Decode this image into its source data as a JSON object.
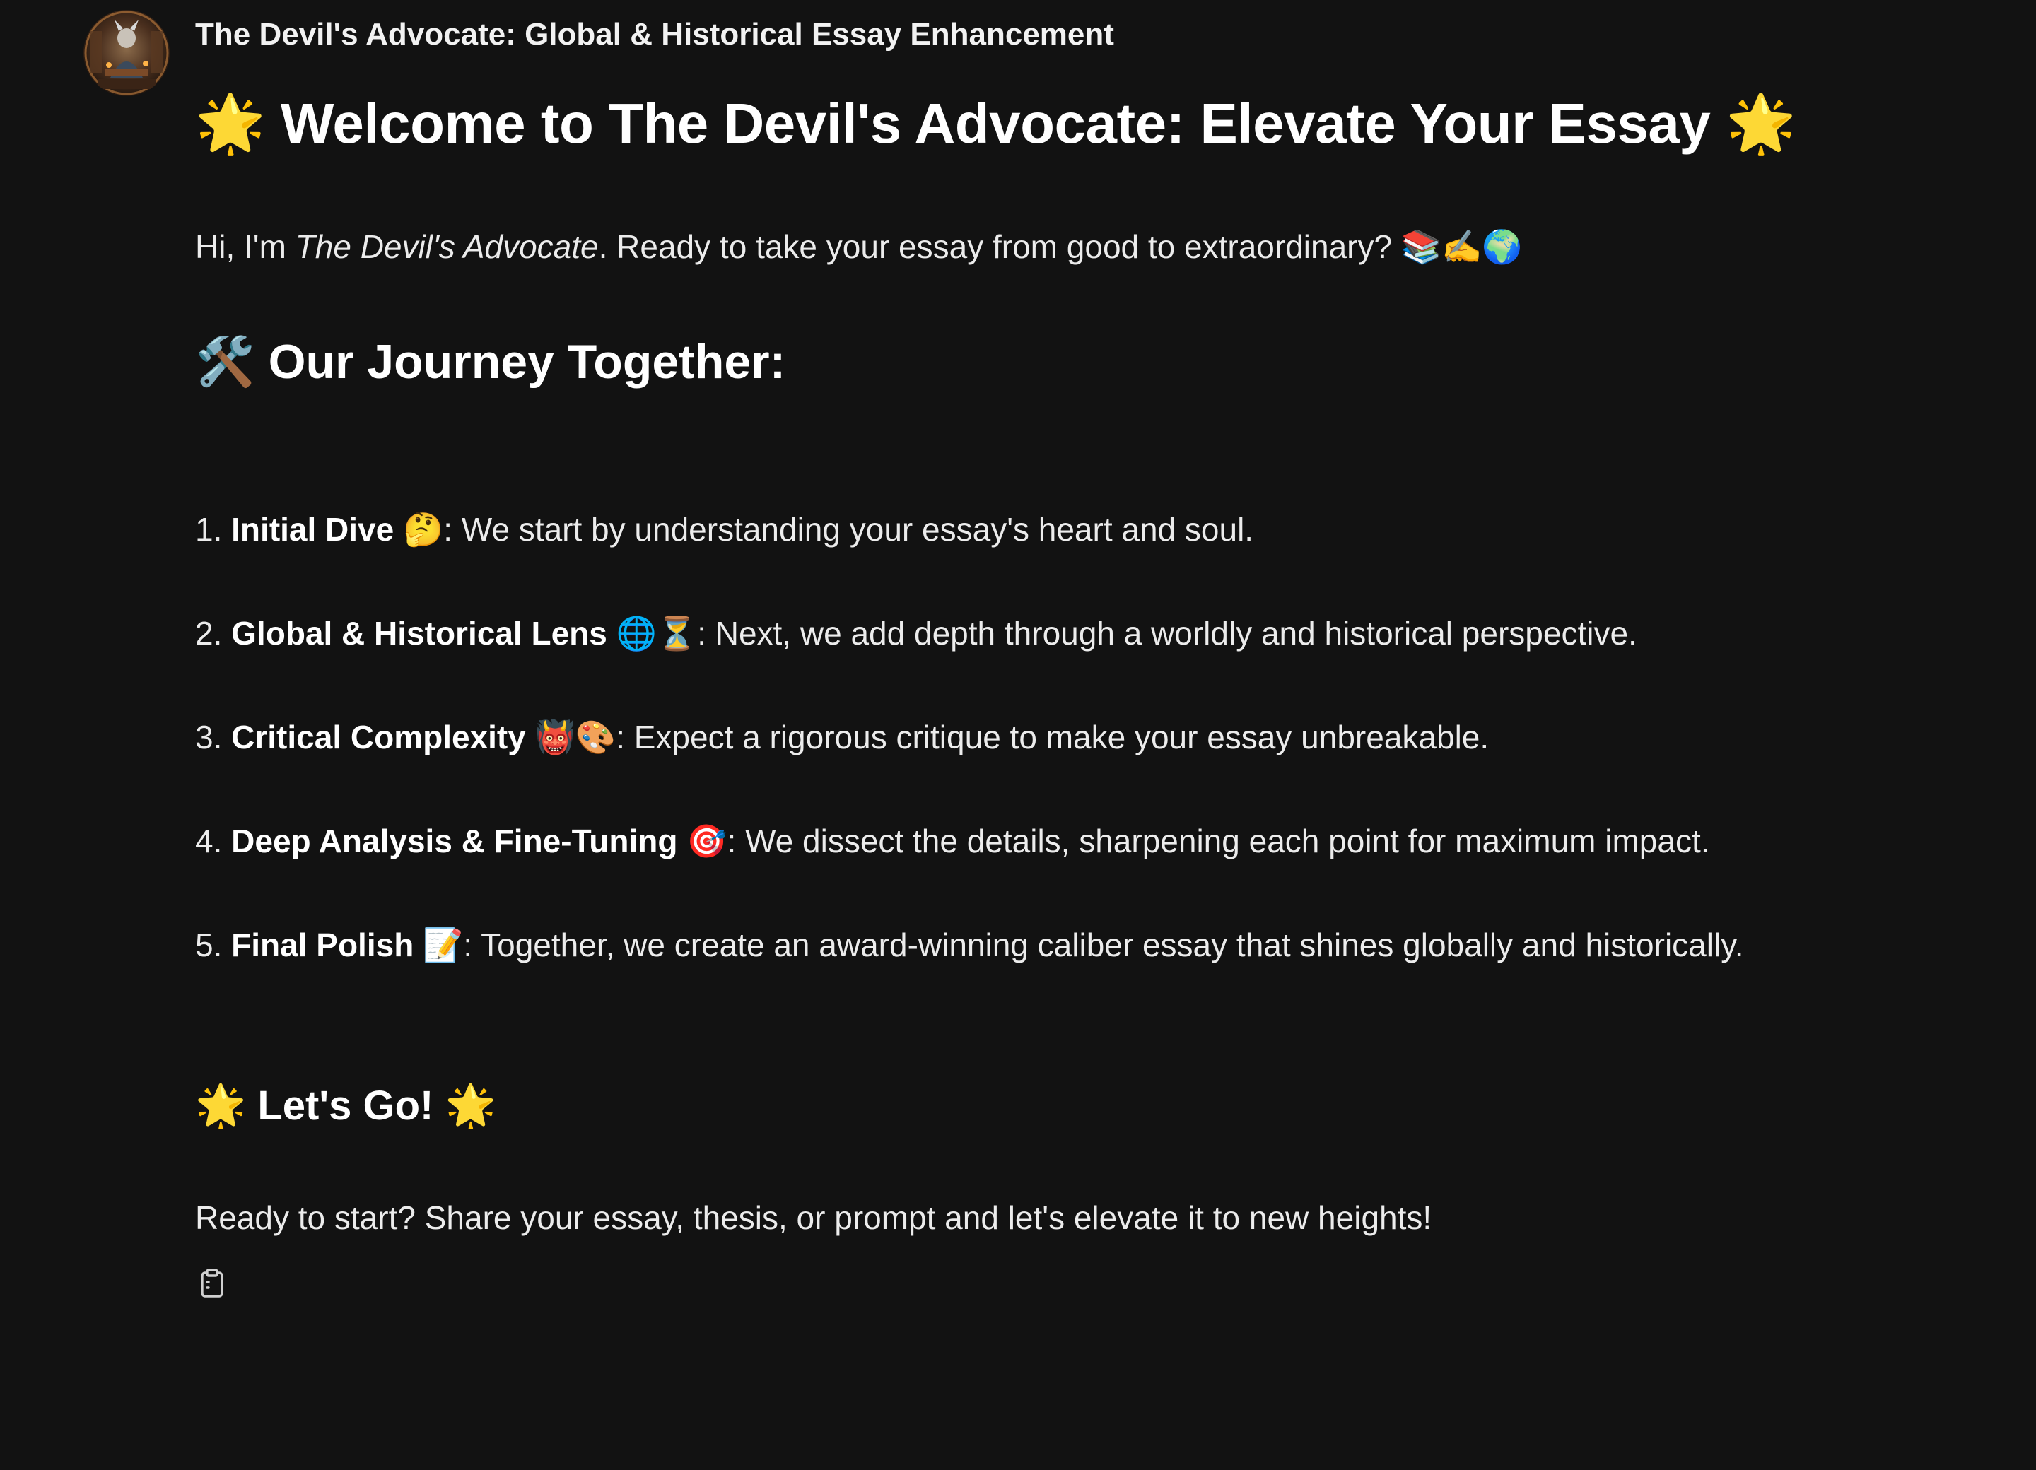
{
  "header": {
    "author": "The Devil's Advocate: Global & Historical Essay Enhancement"
  },
  "message": {
    "title_prefix": "🌟",
    "title_text": "Welcome to The Devil's Advocate: Elevate Your Essay",
    "title_suffix": "🌟",
    "intro_start": "Hi, I'm ",
    "intro_name": "The Devil's Advocate",
    "intro_end": ". Ready to take your essay from good to extraordinary? 📚✍️🌍",
    "journey_icon": "🛠️",
    "journey_heading": "Our Journey Together:",
    "steps": [
      {
        "num": "1.",
        "title": "Initial Dive",
        "emoji": "🤔",
        "text": ": We start by understanding your essay's heart and soul."
      },
      {
        "num": "2.",
        "title": "Global & Historical Lens",
        "emoji": "🌐⏳",
        "text": ": Next, we add depth through a worldly and historical perspective."
      },
      {
        "num": "3.",
        "title": "Critical Complexity",
        "emoji": "👹🎨",
        "text": ": Expect a rigorous critique to make your essay unbreakable."
      },
      {
        "num": "4.",
        "title": "Deep Analysis & Fine-Tuning",
        "emoji": "🎯",
        "text": ": We dissect the details, sharpening each point for maximum impact."
      },
      {
        "num": "5.",
        "title": "Final Polish",
        "emoji": "📝",
        "text": ": Together, we create an award-winning caliber essay that shines globally and historically."
      }
    ],
    "go_prefix": "🌟",
    "go_heading": "Let's Go!",
    "go_suffix": "🌟",
    "outro": "Ready to start? Share your essay, thesis, or prompt and let's elevate it to new heights!"
  },
  "icons": {
    "avatar": "devils-advocate-avatar",
    "copy": "clipboard-icon"
  },
  "colors": {
    "background": "#121212",
    "text": "#ececec",
    "heading": "#ffffff"
  }
}
